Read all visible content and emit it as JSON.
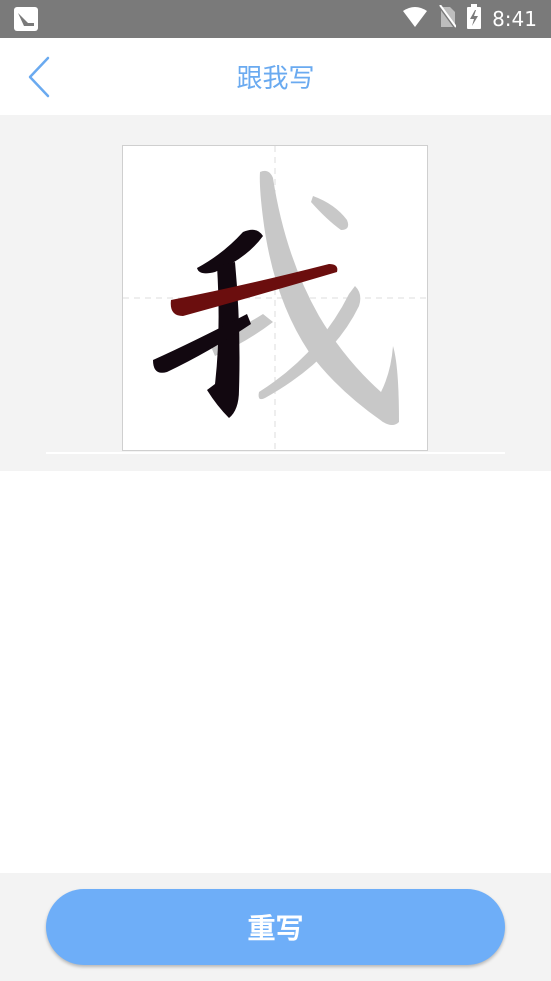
{
  "status_bar": {
    "time": "8:41",
    "icons": [
      "app-notification-icon",
      "wifi-icon",
      "no-sim-icon",
      "battery-charging-icon"
    ]
  },
  "header": {
    "back_icon": "chevron-left-icon",
    "title": "跟我写"
  },
  "practice": {
    "character": "我",
    "grid": "tian-zi-ge",
    "colors": {
      "guide_stroke": "#c8c8c8",
      "written_stroke": "#120810",
      "active_stroke": "#6b0e0e"
    }
  },
  "footer": {
    "rewrite_label": "重写"
  },
  "colors": {
    "accent": "#6aaaf0",
    "button": "#6eaef8",
    "status_bar": "#7a7a7a",
    "panel_bg": "#f3f3f3"
  }
}
